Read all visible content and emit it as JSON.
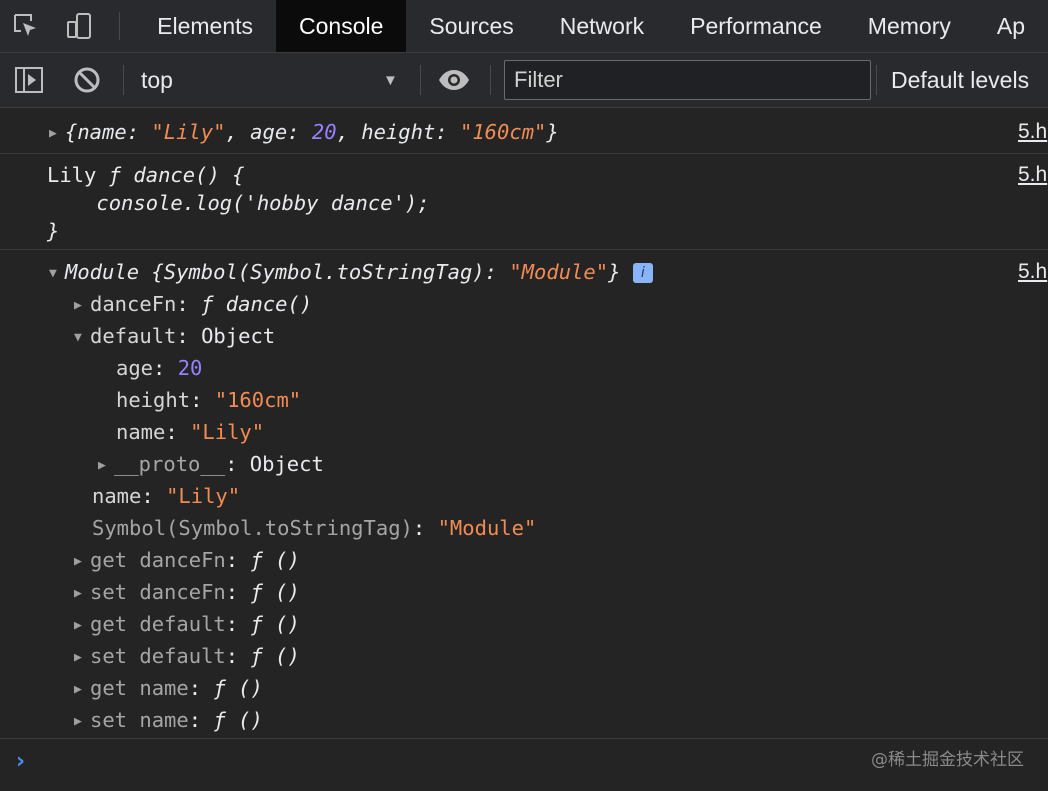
{
  "tabs": [
    "Elements",
    "Console",
    "Sources",
    "Network",
    "Performance",
    "Memory",
    "Ap"
  ],
  "toolbar": {
    "context": "top",
    "filter_placeholder": "Filter",
    "levels": "Default levels"
  },
  "source_link": "5.h",
  "console": {
    "msg1": {
      "open": "{",
      "k1": "name: ",
      "v1": "\"Lily\"",
      "k2": ", age: ",
      "v2": "20",
      "k3": ", height: ",
      "v3": "\"160cm\"",
      "close": "}"
    },
    "msg2": {
      "l1_plain": "Lily ",
      "l1_ital": "ƒ dance() {",
      "l2": "    console.log('hobby dance');",
      "l3": "}"
    },
    "msg3": {
      "header_a": "Module {Symbol(Symbol.toStringTag): ",
      "header_b": "\"Module\"",
      "header_c": "}",
      "info_badge": "i",
      "dance_key": "danceFn",
      "dance_val": "ƒ dance()",
      "default_key": "default",
      "default_val": "Object",
      "age_key": "age",
      "age_val": "20",
      "height_key": "height",
      "height_val": "\"160cm\"",
      "name_key": "name",
      "name_val": "\"Lily\"",
      "proto_key": "__proto__",
      "proto_val": "Object",
      "outer_name_key": "name",
      "outer_name_val": "\"Lily\"",
      "sym_key": "Symbol(Symbol.toStringTag)",
      "sym_val": "\"Module\"",
      "accessors": [
        {
          "label": "get danceFn",
          "val": "ƒ ()"
        },
        {
          "label": "set danceFn",
          "val": "ƒ ()"
        },
        {
          "label": "get default",
          "val": "ƒ ()"
        },
        {
          "label": "set default",
          "val": "ƒ ()"
        },
        {
          "label": "get name",
          "val": "ƒ ()"
        },
        {
          "label": "set name",
          "val": "ƒ ()"
        }
      ]
    }
  },
  "prompt": "›",
  "watermark": "@稀土掘金技术社区",
  "colors": {
    "string": "#f28b54",
    "number": "#9980ff",
    "active_tab_bg": "#0b0b0b",
    "prompt": "#4a8ef5"
  }
}
